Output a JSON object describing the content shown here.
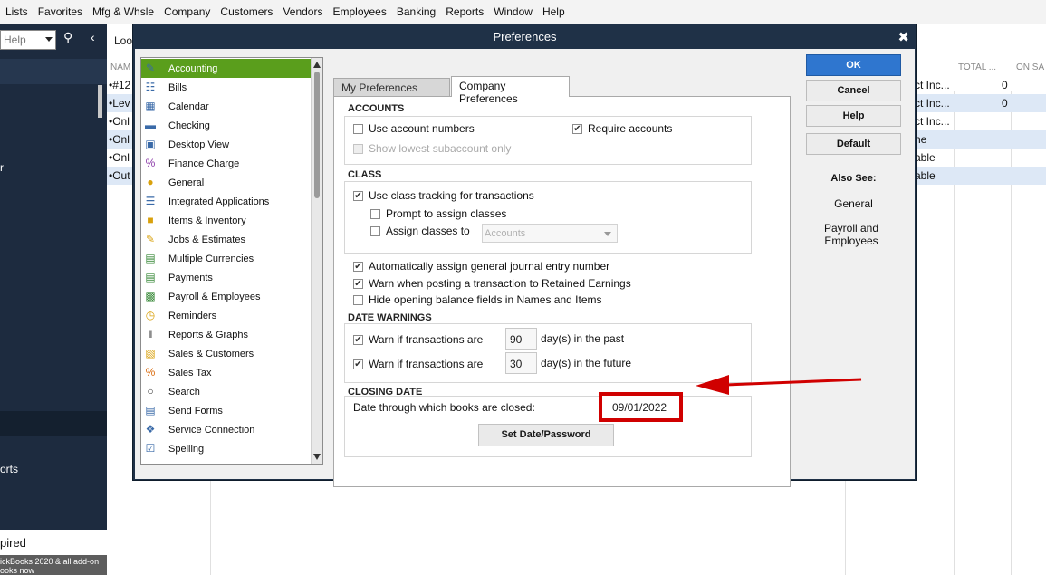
{
  "menubar": [
    "Lists",
    "Favorites",
    "Mfg & Whsle",
    "Company",
    "Customers",
    "Vendors",
    "Employees",
    "Banking",
    "Reports",
    "Window",
    "Help"
  ],
  "leftnav": {
    "search_text": "Help",
    "items": [
      "r",
      "orts"
    ],
    "bottom_text": "pired",
    "footer_text": "ickBooks 2020 & all add-on ooks now"
  },
  "background": {
    "look_label": "Loo",
    "col_name": "NAM",
    "col_total": "TOTAL ...",
    "col_on": "ON SA",
    "rows": [
      {
        "name": "•#12",
        "c2": "ct Inc...",
        "c3": "0"
      },
      {
        "name": "•Lev",
        "c2": "ct Inc...",
        "c3": "0"
      },
      {
        "name": "•Onl",
        "c2": "ct Inc...",
        "c3": ""
      },
      {
        "name": "•Onl",
        "c2": "ne",
        "c3": ""
      },
      {
        "name": "•Onl",
        "c2": "able",
        "c3": ""
      },
      {
        "name": "•Out",
        "c2": "able",
        "c3": ""
      }
    ]
  },
  "dialog": {
    "title": "Preferences",
    "close": "✖",
    "categories": [
      {
        "label": "Accounting",
        "icon": "✎",
        "selected": true
      },
      {
        "label": "Bills",
        "icon": "☷",
        "selected": false
      },
      {
        "label": "Calendar",
        "icon": "▦",
        "selected": false
      },
      {
        "label": "Checking",
        "icon": "▬",
        "selected": false
      },
      {
        "label": "Desktop View",
        "icon": "▣",
        "selected": false
      },
      {
        "label": "Finance Charge",
        "icon": "%",
        "selected": false
      },
      {
        "label": "General",
        "icon": "●",
        "selected": false
      },
      {
        "label": "Integrated Applications",
        "icon": "☰",
        "selected": false
      },
      {
        "label": "Items & Inventory",
        "icon": "■",
        "selected": false
      },
      {
        "label": "Jobs & Estimates",
        "icon": "✎",
        "selected": false
      },
      {
        "label": "Multiple Currencies",
        "icon": "▤",
        "selected": false
      },
      {
        "label": "Payments",
        "icon": "▤",
        "selected": false
      },
      {
        "label": "Payroll & Employees",
        "icon": "▩",
        "selected": false
      },
      {
        "label": "Reminders",
        "icon": "◷",
        "selected": false
      },
      {
        "label": "Reports & Graphs",
        "icon": "‖",
        "selected": false
      },
      {
        "label": "Sales & Customers",
        "icon": "▧",
        "selected": false
      },
      {
        "label": "Sales Tax",
        "icon": "%",
        "selected": false
      },
      {
        "label": "Search",
        "icon": "○",
        "selected": false
      },
      {
        "label": "Send Forms",
        "icon": "▤",
        "selected": false
      },
      {
        "label": "Service Connection",
        "icon": "❖",
        "selected": false
      },
      {
        "label": "Spelling",
        "icon": "☑",
        "selected": false
      }
    ],
    "tabs": {
      "my_prefs": "My Preferences",
      "company_prefs": "Company Preferences"
    },
    "accounts": {
      "header": "ACCOUNTS",
      "use_numbers": "Use account numbers",
      "use_numbers_checked": false,
      "require_accounts": "Require accounts",
      "require_accounts_checked": true,
      "show_lowest": "Show lowest subaccount only",
      "show_lowest_checked": false
    },
    "class": {
      "header": "CLASS",
      "use_class": "Use class tracking for transactions",
      "use_class_checked": true,
      "prompt_assign": "Prompt to assign classes",
      "prompt_assign_checked": false,
      "assign_to": "Assign classes to",
      "assign_to_checked": false,
      "assign_to_value": "Accounts"
    },
    "general_opts": {
      "auto_assign": "Automatically assign general journal entry number",
      "auto_assign_checked": true,
      "warn_retained": "Warn when posting a transaction to Retained Earnings",
      "warn_retained_checked": true,
      "hide_opening": "Hide opening balance fields in Names and Items",
      "hide_opening_checked": false
    },
    "date_warnings": {
      "header": "DATE WARNINGS",
      "warn_label": "Warn if transactions are",
      "past_checked": true,
      "past_days": "90",
      "past_suffix": "day(s) in the past",
      "future_checked": true,
      "future_days": "30",
      "future_suffix": "day(s) in the future"
    },
    "closing_date": {
      "header": "CLOSING DATE",
      "label": "Date through which books are closed:",
      "date": "09/01/2022",
      "set_button": "Set Date/Password"
    },
    "buttons": {
      "ok": "OK",
      "cancel": "Cancel",
      "help": "Help",
      "default": "Default"
    },
    "also_see": {
      "header": "Also See:",
      "links": [
        "General",
        "Payroll and Employees"
      ]
    }
  },
  "colors": {
    "selected_category": "#5a9e1c",
    "ok_button": "#2f76cf",
    "highlight_arrow": "#d00000",
    "dialog_frame": "#1f3147"
  }
}
